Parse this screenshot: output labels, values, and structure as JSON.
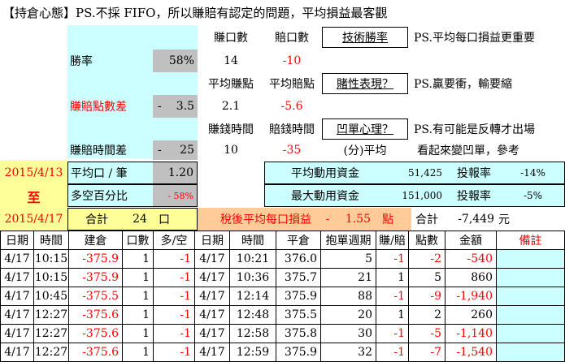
{
  "colors": {
    "cyan": "#ccffff",
    "yellow": "#ffff99",
    "gray": "#c0c0c0",
    "orange": "#ffcc99",
    "red": "#ff0000"
  },
  "title": "【持倉心態】PS.不採 FIFO，所以賺賠有認定的問題，平均損益最客觀",
  "stats": {
    "profit_count_label": "賺口數",
    "loss_count_label": "賠口數",
    "tech_win_label": "技術勝率",
    "note1": "PS.平均每口損益更重要",
    "win_rate_label": "勝率",
    "win_rate": "58%",
    "profit_count": "14",
    "loss_count": "-10",
    "avg_profit_pts_label": "平均賺點",
    "avg_loss_pts_label": "平均賠點",
    "gamble_label": "賭性表現？",
    "note2": "PS.贏要衝，輸要縮",
    "pts_diff_label": "賺賠點數差",
    "pts_diff_sign": "-",
    "pts_diff": "3.5",
    "avg_profit_pts": "2.1",
    "avg_loss_pts": "-5.6",
    "profit_time_label": "賺錢時間",
    "loss_time_label": "賠錢時間",
    "trapped_label": "凹單心理？",
    "note3": "PS.有可能是反轉才出場",
    "time_diff_label": "賺賠時間差",
    "time_diff_sign": "-",
    "time_diff": "25",
    "profit_time": "10",
    "loss_time": "-35",
    "minute_avg": "(分)平均",
    "note4": "看起來變凹單，參考"
  },
  "period": {
    "start": "2015/4/13",
    "to": "至",
    "end": "2015/4/17"
  },
  "summary": {
    "avg_lot_label": "平均口 / 筆",
    "avg_lot": "1.20",
    "ls_ratio_label": "多空百分比",
    "ls_ratio": "- 58%",
    "avg_capital_label": "平均動用資金",
    "avg_capital": "51,425",
    "roi1_label": "投報率",
    "roi1": "-14%",
    "max_capital_label": "最大動用資金",
    "max_capital": "151,000",
    "roi2_label": "投報率",
    "roi2": "-5%",
    "total_label": "合計",
    "total_lots": "24",
    "lot_unit": "口",
    "net_label": "稅後平均每口損益",
    "net_sign": "-",
    "net_value": "1.55",
    "net_unit": "點",
    "total2_label": "合計",
    "total_amount": "-7,449",
    "money_unit": "元"
  },
  "table": {
    "headers": [
      "日期",
      "時間",
      "建倉",
      "口數",
      "多/空",
      "日期",
      "時間",
      "平倉",
      "抱單週期",
      "賺/賠",
      "點數",
      "金額",
      "備註"
    ],
    "rows": [
      [
        "4/17",
        "10:15",
        "-375.9",
        "1",
        "-1",
        "4/17",
        "10:21",
        "376.0",
        "5",
        "-1",
        "-2",
        "-540",
        ""
      ],
      [
        "4/17",
        "10:15",
        "-375.9",
        "1",
        "-1",
        "4/17",
        "10:36",
        "375.7",
        "21",
        "1",
        "5",
        "860",
        ""
      ],
      [
        "4/17",
        "10:45",
        "-375.5",
        "1",
        "-1",
        "4/17",
        "12:14",
        "375.9",
        "88",
        "-1",
        "-9",
        "-1,940",
        ""
      ],
      [
        "4/17",
        "12:27",
        "-375.6",
        "1",
        "-1",
        "4/17",
        "12:48",
        "375.5",
        "20",
        "1",
        "2",
        "260",
        ""
      ],
      [
        "4/17",
        "12:27",
        "-375.6",
        "1",
        "-1",
        "4/17",
        "12:58",
        "375.8",
        "30",
        "-1",
        "-5",
        "-1,140",
        ""
      ],
      [
        "4/17",
        "12:27",
        "-375.6",
        "1",
        "-1",
        "4/17",
        "12:59",
        "375.9",
        "32",
        "-1",
        "-7",
        "-1,540",
        ""
      ]
    ]
  }
}
